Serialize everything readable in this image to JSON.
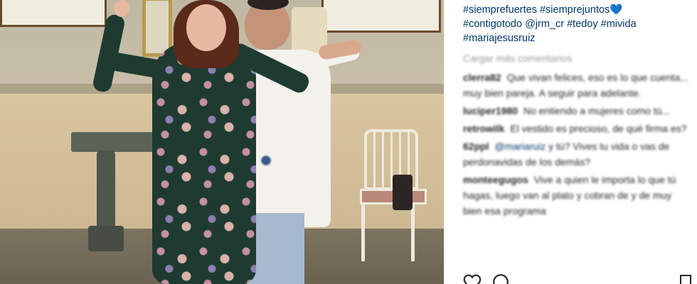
{
  "post": {
    "caption_tags": [
      "#siempre fuertes",
      "#siemprejuntos",
      "#contigotodo",
      "@jrm_cr",
      "#tedoy",
      "#mivida",
      "#mariajesusruiz"
    ],
    "caption_line1": "#siemprefuertes #siemprejuntos",
    "caption_line2": "#contigotodo @jrm_cr #tedoy #mivida",
    "caption_line3": "#mariajesusruiz",
    "heart_glyph": "💙",
    "load_more": "Cargar más comentarios"
  },
  "comments": [
    {
      "user": "clerra82",
      "text": "Que vivan felices, eso es lo que cuenta... muy bien pareja. A seguir para adelante."
    },
    {
      "user": "luciper1980",
      "text": "No entiendo a mujeres como tú..."
    },
    {
      "user": "retrowilk",
      "text": "El vestido es precioso, de qué firma es?"
    },
    {
      "user": "62ppl",
      "mention": "@mariaruiz",
      "text": "y tú? Vives tu vida o vas de perdonavidas de los demás?"
    },
    {
      "user": "monteegugos",
      "text": "Vive a quien le importa lo que tú hagas, luego van al plato y cobran de y de muy bien esa programa"
    }
  ],
  "icons": {
    "like": "heart-outline-icon",
    "comment": "speech-bubble-icon",
    "save": "bookmark-icon"
  },
  "colors": {
    "hashtag": "#003569",
    "text": "#262626",
    "muted": "#999999"
  }
}
